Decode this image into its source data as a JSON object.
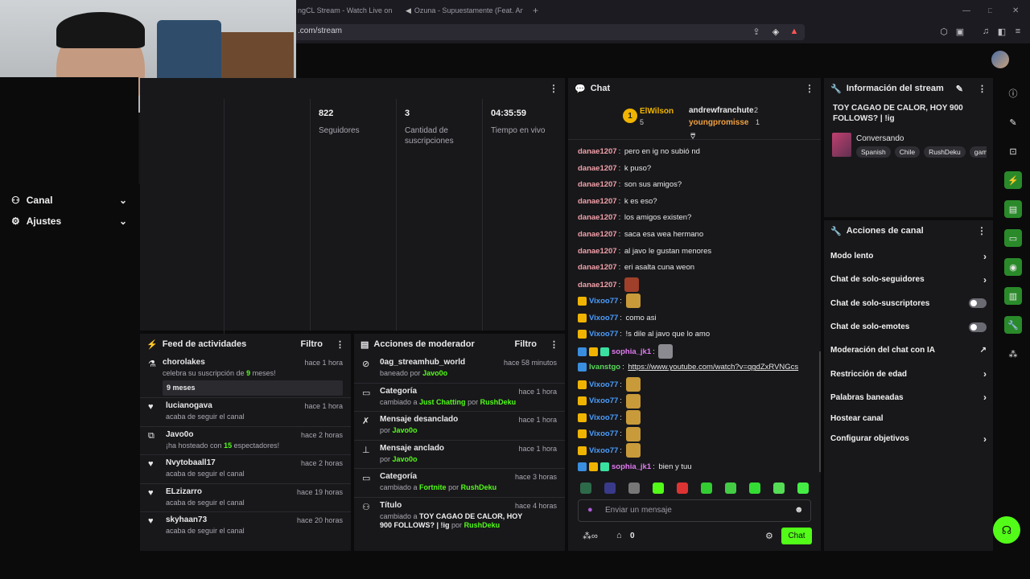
{
  "browser": {
    "tabs": [
      {
        "label": "ngCL Stream - Watch Live on Kick"
      },
      {
        "label": "Ozuna - Supuestamente (Feat. An"
      }
    ],
    "url": ".com/stream"
  },
  "sidebar": {
    "items": [
      {
        "label": "Canal"
      },
      {
        "label": "Ajustes"
      }
    ]
  },
  "stats": [
    {
      "value": "822",
      "label": "Seguidores"
    },
    {
      "value": "3",
      "label": "Cantidad de suscripciones"
    },
    {
      "value": "04:35:59",
      "label": "Tiempo en vivo"
    }
  ],
  "activity_feed": {
    "title": "Feed de actividades",
    "filter_label": "Filtro",
    "items": [
      {
        "name": "chorolakes",
        "time": "hace 1 hora",
        "sub": "celebra su suscripción de",
        "highlight": "9",
        "sub_end": "meses!",
        "extra": "9 meses"
      },
      {
        "name": "lucianogava",
        "time": "hace 1 hora",
        "sub": "acaba de seguir el canal"
      },
      {
        "name": "Javo0o",
        "time": "hace 2 horas",
        "sub": "¡ha hosteado con",
        "highlight": "15",
        "sub_end": "espectadores!"
      },
      {
        "name": "Nvytobaall17",
        "time": "hace 2 horas",
        "sub": "acaba de seguir el canal"
      },
      {
        "name": "ELzizarro",
        "time": "hace 19 horas",
        "sub": "acaba de seguir el canal"
      },
      {
        "name": "skyhaan73",
        "time": "hace 20 horas",
        "sub": "acaba de seguir el canal"
      }
    ]
  },
  "mod_actions": {
    "title": "Acciones de moderador",
    "filter_label": "Filtro",
    "items": [
      {
        "name": "0ag_streamhub_world",
        "time": "hace 58 minutos",
        "sub": "baneado por",
        "by": "Javo0o"
      },
      {
        "name": "Categoría",
        "time": "hace 1 hora",
        "sub": "cambiado a",
        "target": "Just Chatting",
        "por": "por",
        "by": "RushDeku"
      },
      {
        "name": "Mensaje desanclado",
        "time": "hace 1 hora",
        "sub": "por",
        "by": "Javo0o"
      },
      {
        "name": "Mensaje anclado",
        "time": "hace 1 hora",
        "sub": "por",
        "by": "Javo0o"
      },
      {
        "name": "Categoría",
        "time": "hace 3 horas",
        "sub": "cambiado a",
        "target": "Fortnite",
        "por": "por",
        "by": "RushDeku"
      },
      {
        "name": "Título",
        "time": "hace 4 horas",
        "sub": "cambiado a",
        "target": "TOY CAGAO DE CALOR, HOY 900 FOLLOWS? | !ig",
        "por": "por",
        "by": "RushDeku"
      }
    ]
  },
  "chat": {
    "title": "Chat",
    "leaderboard": {
      "first": {
        "rank": "1",
        "name": "ElWilson",
        "count": "5"
      },
      "others": [
        {
          "name": "andrewfranchute",
          "count": "2"
        },
        {
          "name": "youngpromisse",
          "count": "1"
        }
      ]
    },
    "messages": [
      {
        "user": "danae1207",
        "text": "pero en ig no subió nd"
      },
      {
        "user": "danae1207",
        "text": "k puso?"
      },
      {
        "user": "danae1207",
        "text": "son sus amigos?"
      },
      {
        "user": "danae1207",
        "text": "k es eso?"
      },
      {
        "user": "danae1207",
        "text": "los amigos existen?"
      },
      {
        "user": "danae1207",
        "text": "saca esa wea hermano"
      },
      {
        "user": "danae1207",
        "text": "al javo le gustan menores"
      },
      {
        "user": "danae1207",
        "text": "eri asalta cuna weon"
      },
      {
        "user": "danae1207",
        "text": ""
      },
      {
        "user": "Vixoo77",
        "text": ""
      },
      {
        "user": "Vixoo77",
        "text": "como asi"
      },
      {
        "user": "Vixoo77",
        "text": "!s dile al javo que lo amo"
      },
      {
        "user": "sophia_jk1",
        "text": ""
      },
      {
        "user": "Ivanstgo",
        "text": "https://www.youtube.com/watch?v=qgdZxRVNGcs"
      },
      {
        "user": "Vixoo77",
        "text": ""
      },
      {
        "user": "Vixoo77",
        "text": ""
      },
      {
        "user": "Vixoo77",
        "text": ""
      },
      {
        "user": "Vixoo77",
        "text": ""
      },
      {
        "user": "Vixoo77",
        "text": ""
      },
      {
        "user": "sophia_jk1",
        "text": "bien y tuu"
      }
    ],
    "input_placeholder": "Enviar un mensaje",
    "points": "0",
    "send_label": "Chat"
  },
  "stream_info": {
    "title": "Información del stream",
    "stream_title": "TOY CAGAO DE CALOR, HOY 900 FOLLOWS? | !ig",
    "category": "Conversando",
    "tags": [
      "Spanish",
      "Chile",
      "RushDeku",
      "gami"
    ]
  },
  "channel_actions": {
    "title": "Acciones de canal",
    "items": [
      {
        "label": "Modo lento"
      },
      {
        "label": "Chat de solo-seguidores"
      },
      {
        "label": "Chat de solo-suscriptores"
      },
      {
        "label": "Chat de solo-emotes"
      },
      {
        "label": "Moderación del chat con IA"
      },
      {
        "label": "Restricción de edad"
      },
      {
        "label": "Palabras baneadas"
      },
      {
        "label": "Hostear canal"
      },
      {
        "label": "Configurar objetivos"
      }
    ]
  },
  "colors": {
    "accent": "#53fc18",
    "panel": "#18181b",
    "bg": "#0b0b0c",
    "username": "#f0a0a8",
    "vixoo": "#4a9eff",
    "sophia": "#e07af0",
    "ivan": "#5bd75b"
  }
}
